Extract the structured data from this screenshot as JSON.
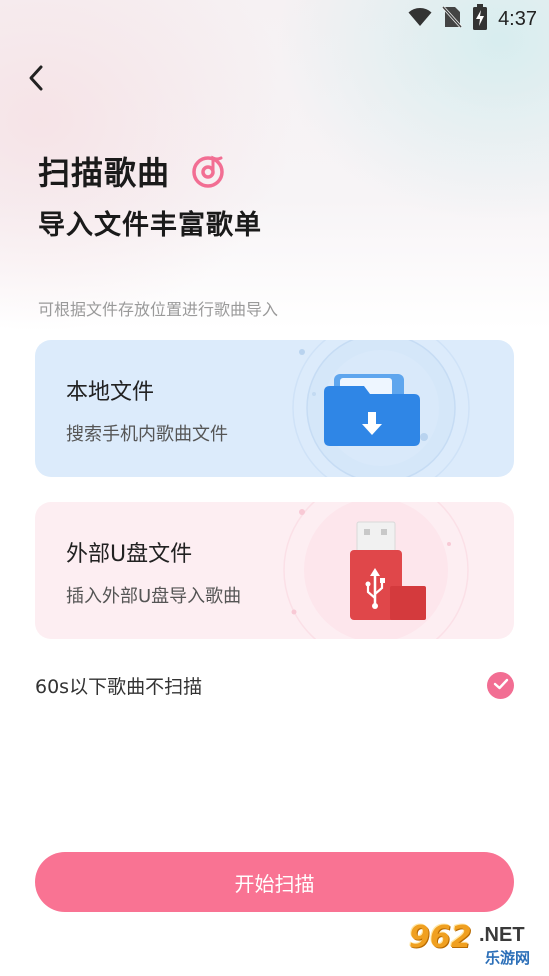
{
  "status_bar": {
    "time": "4:37",
    "icons": [
      "wifi-icon",
      "no-sim-icon",
      "battery-charging-icon"
    ]
  },
  "header": {
    "back_icon": "chevron-left-icon",
    "title": "扫描歌曲",
    "title_icon": "music-disc-icon",
    "subtitle": "导入文件丰富歌单"
  },
  "hint": "可根据文件存放位置进行歌曲导入",
  "cards": [
    {
      "title": "本地文件",
      "desc": "搜索手机内歌曲文件",
      "icon": "folder-download-icon",
      "background": "#dcebfb"
    },
    {
      "title": "外部U盘文件",
      "desc": "插入外部U盘导入歌曲",
      "icon": "usb-drive-icon",
      "background": "#fdeef2"
    }
  ],
  "option": {
    "label": "60s以下歌曲不扫描",
    "checked": true
  },
  "start_button": {
    "label": "开始扫描",
    "color": "#f97393"
  },
  "watermark": {
    "number": "962",
    "domain": ".NET",
    "site": "乐游网"
  },
  "colors": {
    "accent": "#f26e93",
    "folder_blue": "#2f86e6",
    "usb_red": "#e0474a"
  }
}
